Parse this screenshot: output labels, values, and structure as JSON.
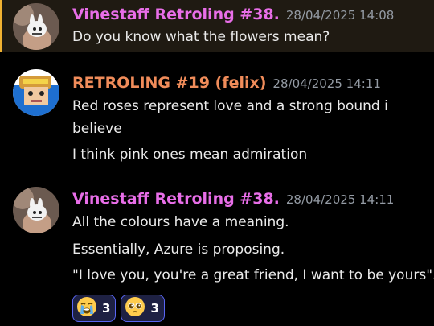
{
  "messages": [
    {
      "username": "Vinestaff Retroling #38.",
      "timestamp": "28/04/2025 14:08",
      "lines": [
        "Do you know what the flowers mean?"
      ],
      "name_color": "#e86ee8",
      "avatar": "bunny-plush-avatar"
    },
    {
      "username": "RETROLING #19 (felix)",
      "timestamp": "28/04/2025 14:11",
      "lines": [
        "Red roses represent love and a strong bound i",
        "believe",
        "I think pink ones mean admiration"
      ],
      "name_color": "#f08c5a",
      "avatar": "cartoon-portrait-avatar"
    },
    {
      "username": "Vinestaff Retroling #38.",
      "timestamp": "28/04/2025 14:11",
      "lines": [
        "All the colours have a meaning.",
        "Essentially, Azure is proposing.",
        "\"I love you, you're a great friend, I want to be yours\"."
      ],
      "name_color": "#e86ee8",
      "avatar": "bunny-plush-avatar"
    }
  ],
  "reactions": [
    {
      "emoji": "loudly-crying-face",
      "count": "3"
    },
    {
      "emoji": "pleading-face",
      "count": "3"
    }
  ],
  "colors": {
    "background": "#000000",
    "highlight": "#1f1a12",
    "highlight_bar": "#f0b232",
    "reaction_border": "#5865f2",
    "reaction_bg": "#1e2143",
    "text": "#eaeaea",
    "timestamp": "#949ba4"
  }
}
